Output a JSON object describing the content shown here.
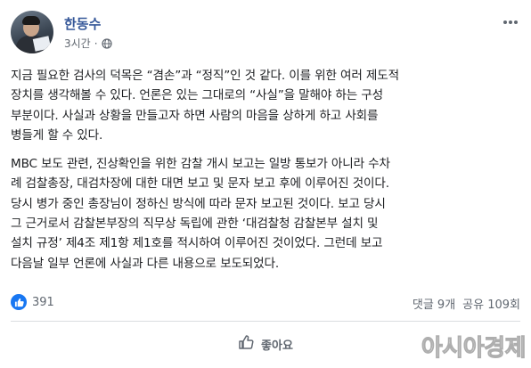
{
  "post": {
    "author": "한동수",
    "timestamp": "3시간",
    "privacy_icon": "globe-icon",
    "paragraphs": [
      "지금 필요한 검사의 덕목은 “겸손”과 “정직”인 것 같다. 이를 위한 여러 제도적\n장치를 생각해볼 수 있다. 언론은 있는 그대로의 “사실”을 말해야 하는 구성\n부분이다. 사실과 상황을 만들고자 하면 사람의 마음을 상하게 하고 사회를\n병들게 할 수 있다.",
      "MBC 보도 관련, 진상확인을 위한 감찰 개시 보고는 일방 통보가 아니라 수차\n례 검찰총장, 대검차장에 대한 대면 보고 및 문자 보고 후에 이루어진 것이다.\n당시 병가 중인 총장님이 정하신 방식에 따라 문자 보고된 것이다. 보고 당시\n그 근거로서 감찰본부장의 직무상 독립에 관한 ‘대검찰청 감찰본부 설치 및\n설치 규정’ 제4조 제1항 제1호를 적시하여 이루어진 것이었다. 그런데 보고\n다음날 일부 언론에 사실과 다른 내용으로 보도되었다."
    ]
  },
  "stats": {
    "reaction_count": "391",
    "comments": "댓글 9개",
    "shares": "공유 109회"
  },
  "actions": {
    "like_label": "좋아요"
  },
  "watermark": "아시아경제",
  "colors": {
    "accent": "#1877f2",
    "author_link": "#365899",
    "meta": "#606770",
    "text": "#1c1e21"
  }
}
